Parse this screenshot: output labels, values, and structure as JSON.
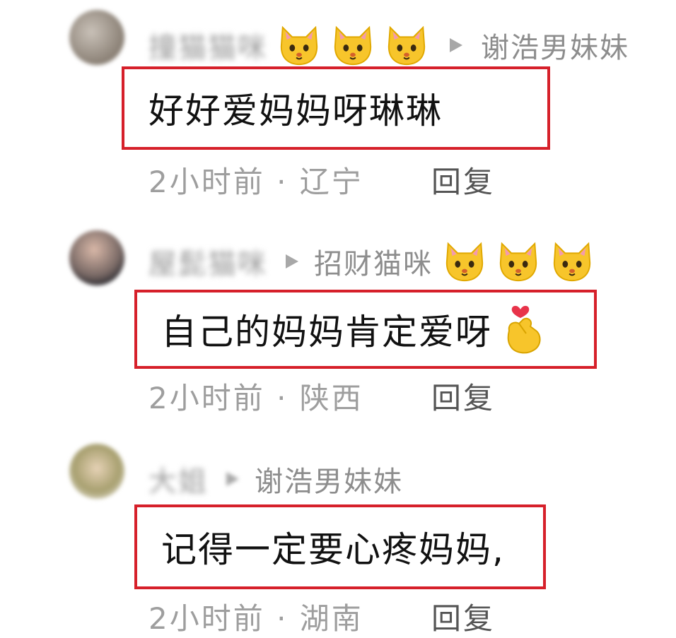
{
  "comments": [
    {
      "username": "撞猫猫咪",
      "reply_to": "谢浩男妹妹",
      "text": "好好爱妈妈呀琳琳",
      "time": "2小时前",
      "location": "辽宁",
      "reply_label": "回复",
      "cat_icons": [
        "cat-face-icon",
        "cat-face-icon",
        "cat-face-icon"
      ]
    },
    {
      "username": "屋髭猫咪",
      "reply_to": "招财猫咪",
      "text": "自己的妈妈肯定爱呀",
      "time": "2小时前",
      "location": "陕西",
      "reply_label": "回复",
      "cat_icons": [
        "cat-face-icon",
        "cat-face-icon",
        "cat-face-icon"
      ],
      "trailing_emoji": "finger-heart-icon"
    },
    {
      "username": "大姐",
      "reply_to": "谢浩男妹妹",
      "text": "记得一定要心疼妈妈,",
      "time": "2小时前",
      "location": "湖南",
      "reply_label": "回复"
    }
  ],
  "colors": {
    "highlight_border": "#d6202a",
    "meta_text": "#9e9e9e",
    "cat_yellow": "#f7c52b"
  }
}
